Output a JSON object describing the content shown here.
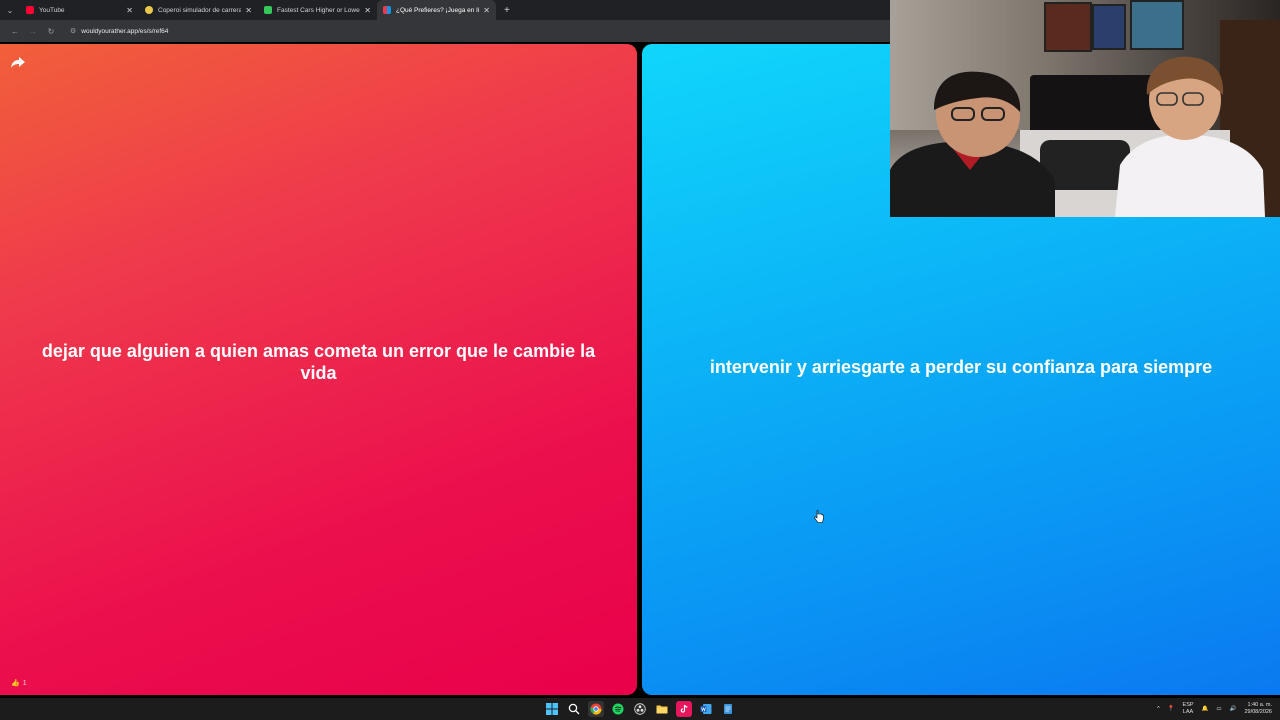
{
  "browser": {
    "tabs": [
      {
        "title": "YouTube",
        "color": "#ff0033",
        "active": false
      },
      {
        "title": "Coperoi simulador de carrera N",
        "color": "#e8c74a",
        "active": false
      },
      {
        "title": "Fastest Cars Higher or Lower G",
        "color": "#35c759",
        "active": false
      },
      {
        "title": "¿Qué Prefieres? ¡Juega en línea!",
        "color": "#8a5cf6",
        "active": true
      }
    ],
    "url": "wouldyourather.app/es/s/ref64"
  },
  "game": {
    "option_left": "dejar que alguien a quien amas cometa un error que le cambie la vida",
    "option_right": "intervenir y arriesgarte a perder su confianza para siempre",
    "likes": "1"
  },
  "taskbar": {
    "lang_line1": "ESP",
    "lang_line2": "LAA",
    "time": "1:40 a. m.",
    "date": "29/08/2026"
  }
}
